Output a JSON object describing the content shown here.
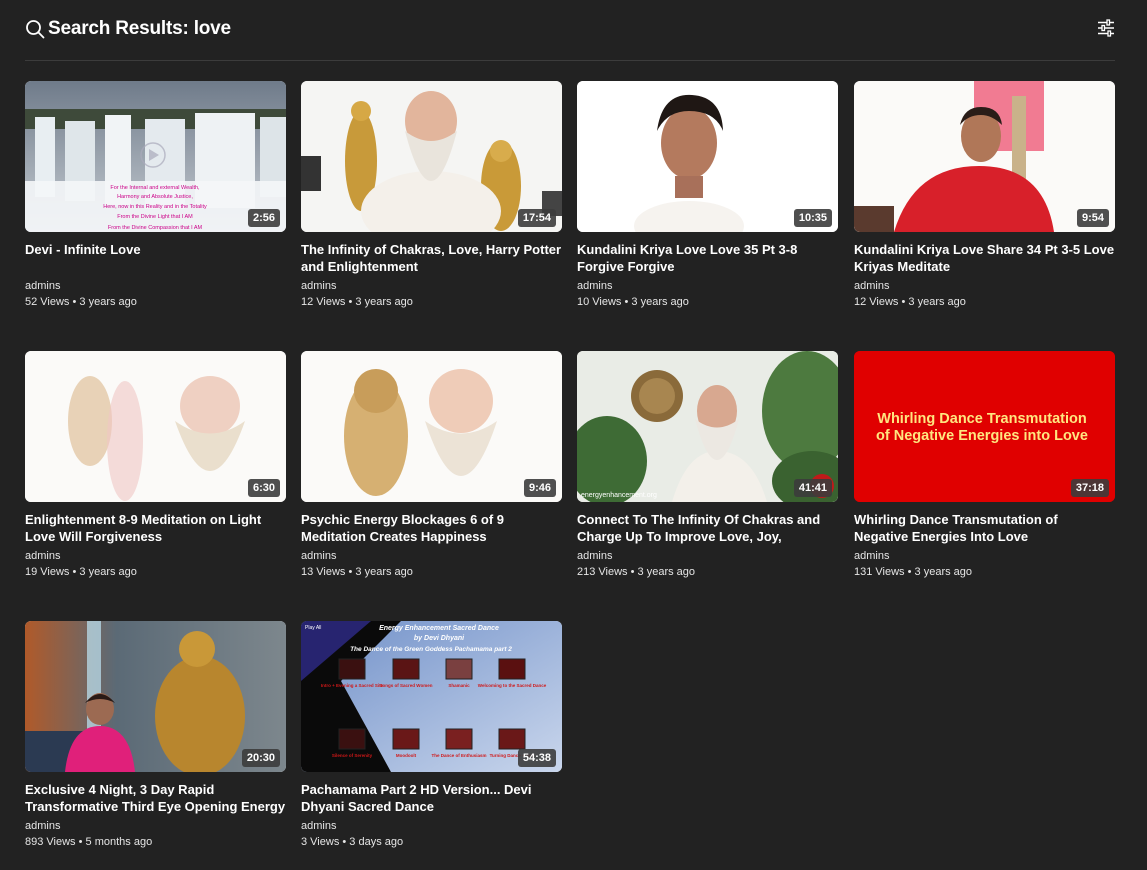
{
  "header": {
    "title": "Search Results: love"
  },
  "videos": [
    {
      "title": "Devi - Infinite Love",
      "author": "admins",
      "views": "52 Views",
      "age": "3 years ago",
      "duration": "2:56",
      "thumb_text": [
        "For the Internal and external Wealth,",
        "Harmony and Absolute Justice,",
        "Here, now in this Reality and in the Totality",
        "From the Divine Light that I AM",
        "From the Divine Compassion that I AM"
      ]
    },
    {
      "title": "The Infinity of Chakras, Love, Harry Potter and Enlightenment",
      "author": "admins",
      "views": "12 Views",
      "age": "3 years ago",
      "duration": "17:54"
    },
    {
      "title": "Kundalini Kriya Love Love 35 Pt 3-8 Forgive Forgive",
      "author": "admins",
      "views": "10 Views",
      "age": "3 years ago",
      "duration": "10:35"
    },
    {
      "title": "Kundalini Kriya Love Share 34 Pt 3-5 Love Kriyas Meditate",
      "author": "admins",
      "views": "12 Views",
      "age": "3 years ago",
      "duration": "9:54"
    },
    {
      "title": "Enlightenment 8-9 Meditation on Light Love Will Forgiveness",
      "author": "admins",
      "views": "19 Views",
      "age": "3 years ago",
      "duration": "6:30"
    },
    {
      "title": "Psychic Energy Blockages 6 of 9 Meditation Creates Happiness",
      "author": "admins",
      "views": "13 Views",
      "age": "3 years ago",
      "duration": "9:46"
    },
    {
      "title": "Connect To The Infinity Of Chakras and Charge Up To Improve Love, Joy,",
      "author": "admins",
      "views": "213 Views",
      "age": "3 years ago",
      "duration": "41:41",
      "thumb_text": [
        "energyenhancement.org"
      ]
    },
    {
      "title": "Whirling Dance Transmutation of Negative Energies Into Love",
      "author": "admins",
      "views": "131 Views",
      "age": "3 years ago",
      "duration": "37:18",
      "thumb_text": [
        "Whirling Dance Transmutation",
        "of Negative Energies into Love"
      ]
    },
    {
      "title": "Exclusive 4 Night, 3 Day Rapid Transformative Third Eye Opening Energy",
      "author": "admins",
      "views": "893 Views",
      "age": "5 months ago",
      "duration": "20:30"
    },
    {
      "title": "Pachamama Part 2 HD Version... Devi Dhyani Sacred Dance",
      "author": "admins",
      "views": "3 Views",
      "age": "3 days ago",
      "duration": "54:38",
      "thumb_text": [
        "Play All",
        "Energy Enhancement Sacred Dance",
        "by Devi Dhyani",
        "The Dance of the Green Goddess Pachamama part 2",
        "Intro + Evening a Sacred Site",
        "Songs of Sacred Women",
        "Shamanic",
        "Welcoming to the Sacred Dance",
        "Silence of Serenity",
        "Moodoolt",
        "The Dance of Enthusiasm",
        "Turning Dance + Sufi"
      ]
    }
  ],
  "separator": " • ",
  "colors": {
    "background": "#222222",
    "text": "#ffffff",
    "meta_text": "#e6e6e6",
    "duration_badge": "#3c3c3c",
    "whirling_red": "#e00000"
  },
  "icons": {
    "search": "search-icon",
    "filter": "filter-sliders-icon"
  }
}
